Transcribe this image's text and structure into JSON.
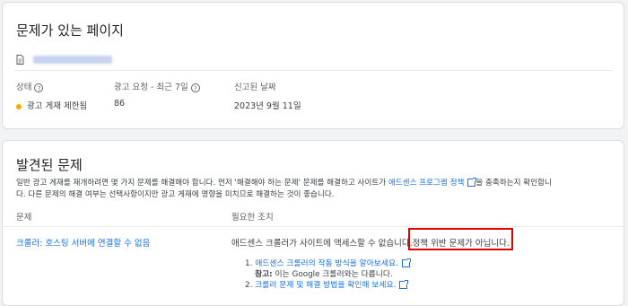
{
  "pages_card": {
    "title": "문제가 있는 페이지",
    "headers": {
      "status": "상태",
      "ad_requests": "광고 요청 - 최근 7일",
      "reported_date": "신고된 날짜"
    },
    "row": {
      "status": "광고 게재 제한됨",
      "ad_requests": "86",
      "reported_date": "2023년 9월 11일"
    },
    "colors": {
      "status_dot": "#f9ab00"
    }
  },
  "issues_card": {
    "title": "발견된 문제",
    "intro_part1": "일반 광고 게재를 재개하려면 몇 가지 문제를 해결해야 합니다. 먼저 '해결해야 하는 문제' 문제를 해결하고 사이트가",
    "intro_link": "애드센스 프로그램 정책",
    "intro_part2": "을 충족하는지 확인합니",
    "intro_line2": "다. 다른 문제의 해결 여부는 선택사항이지만 광고 게재에 영향을 미치므로 해결하는 것이 좋습니다.",
    "col_issue": "문제",
    "col_action": "필요한 조치",
    "issue_link": "크롤러: 호스팅 서버에 연결할 수 없음",
    "action_text": "애드센스 크롤러가 사이트에 액세스할 수 없습니다.",
    "action_highlight": "정책 위반 문제가 아닙니다.",
    "step1_link": "애드센스 크롤러의 작동 방식을 알아보세요.",
    "note_label": "참고:",
    "note_text": "이는 Google 크롤러와는 다릅니다.",
    "step2_link": "크롤러 문제 및 해결 방법을 확인해 보세요.",
    "step1_num": "1.",
    "step2_num": "2."
  },
  "icons": {
    "page": "document-icon",
    "help": "help-circle-icon",
    "external": "open-in-new-icon"
  }
}
